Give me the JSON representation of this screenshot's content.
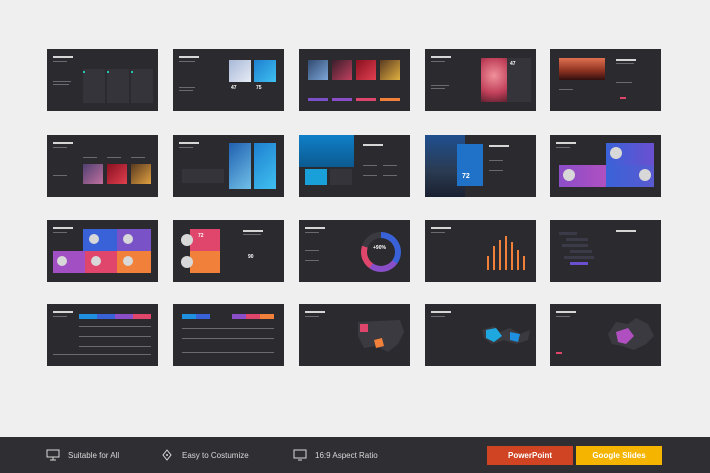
{
  "features": [
    {
      "label": "Suitable for All",
      "icon": "presentation-icon"
    },
    {
      "label": "Easy to Costumize",
      "icon": "pen-tool-icon"
    },
    {
      "label": "16:9 Aspect Ratio",
      "icon": "monitor-icon"
    }
  ],
  "buttons": {
    "powerpoint": "PowerPoint",
    "google_slides": "Google Slides"
  },
  "slide_numbers": {
    "r1c4": "47",
    "r1c2a": "47",
    "r1c2b": "75",
    "r2c4": "72",
    "r3c2a": "72",
    "r3c2b": "90",
    "r3c3": "+90%"
  },
  "colors": {
    "background": "#efefef",
    "slide_bg": "#2b2b2f",
    "footer_bg": "#2e2e33",
    "powerpoint": "#d04423",
    "google_slides": "#f4b400",
    "accent_blue": "#3a62d8",
    "accent_purple": "#8b4ec9",
    "accent_pink": "#e0456c",
    "accent_orange": "#f0803a"
  }
}
